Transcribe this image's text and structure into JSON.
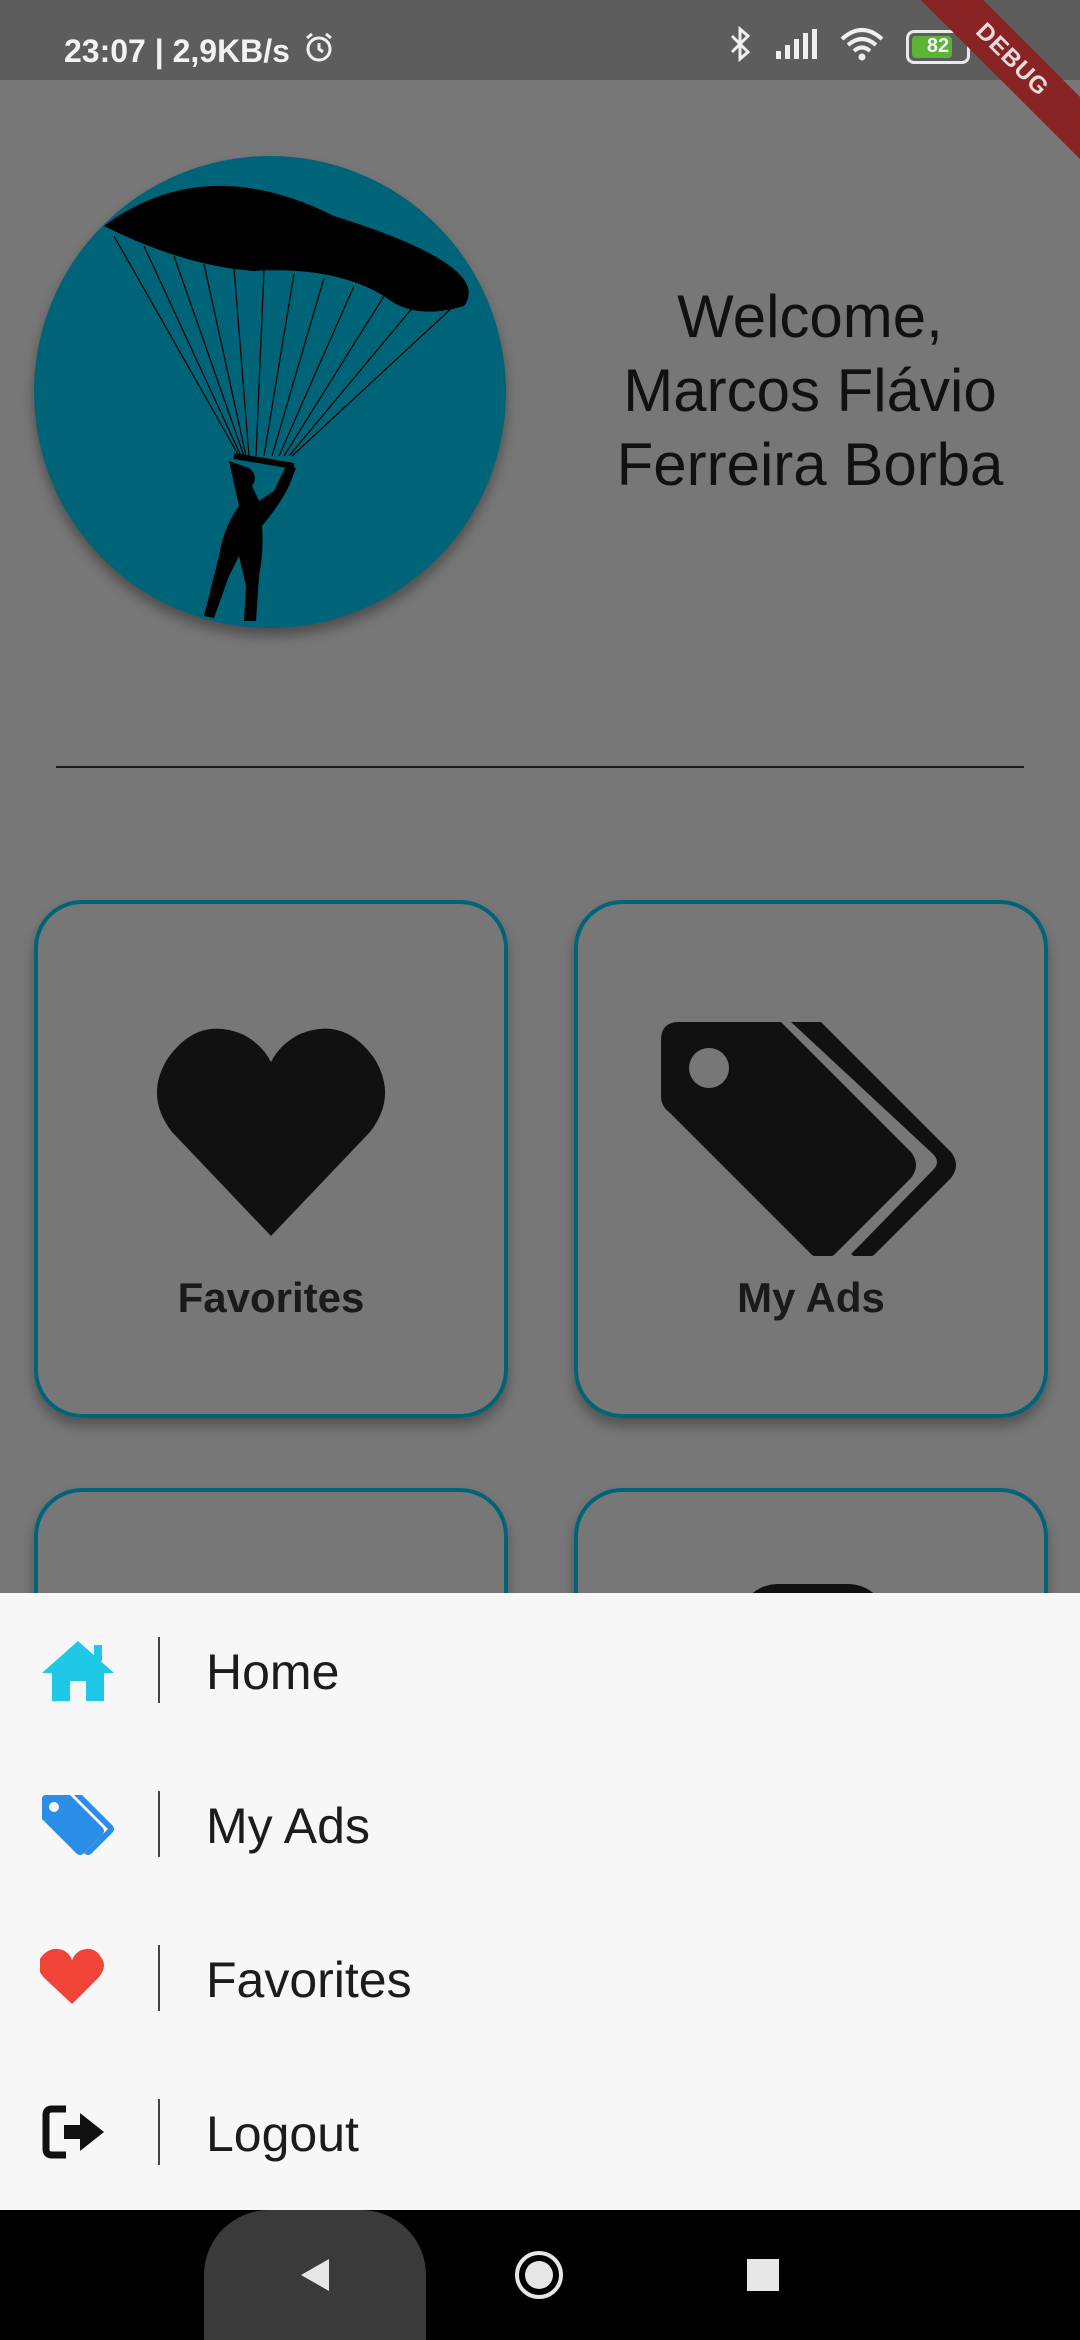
{
  "status_bar": {
    "time_and_speed": "23:07 | 2,9KB/s",
    "battery_level": "82",
    "debug_banner": "DEBUG",
    "icons": [
      "alarm-icon",
      "bluetooth-icon",
      "signal-icon",
      "wifi-icon",
      "battery-icon"
    ]
  },
  "header": {
    "welcome_text": "Welcome,\nMarcos Flávio\nFerreira Borba",
    "avatar_icon": "paraglider-icon",
    "avatar_color": "#006478"
  },
  "cards": [
    {
      "label": "Favorites",
      "icon": "heart-icon"
    },
    {
      "label": "My Ads",
      "icon": "tags-icon"
    }
  ],
  "menu": {
    "items": [
      {
        "label": "Home",
        "icon": "home-icon",
        "color": "#1ec8e6"
      },
      {
        "label": "My Ads",
        "icon": "tags-icon",
        "color": "#2a8ee6"
      },
      {
        "label": "Favorites",
        "icon": "heart-icon",
        "color": "#f04438"
      },
      {
        "label": "Logout",
        "icon": "logout-icon",
        "color": "#111111"
      }
    ]
  },
  "nav_bar": {
    "buttons": [
      "back-icon",
      "home-circle-icon",
      "recents-icon"
    ]
  },
  "colors": {
    "accent": "#006478",
    "overlay_background": "#777777",
    "menu_background": "#f7f7f7"
  }
}
